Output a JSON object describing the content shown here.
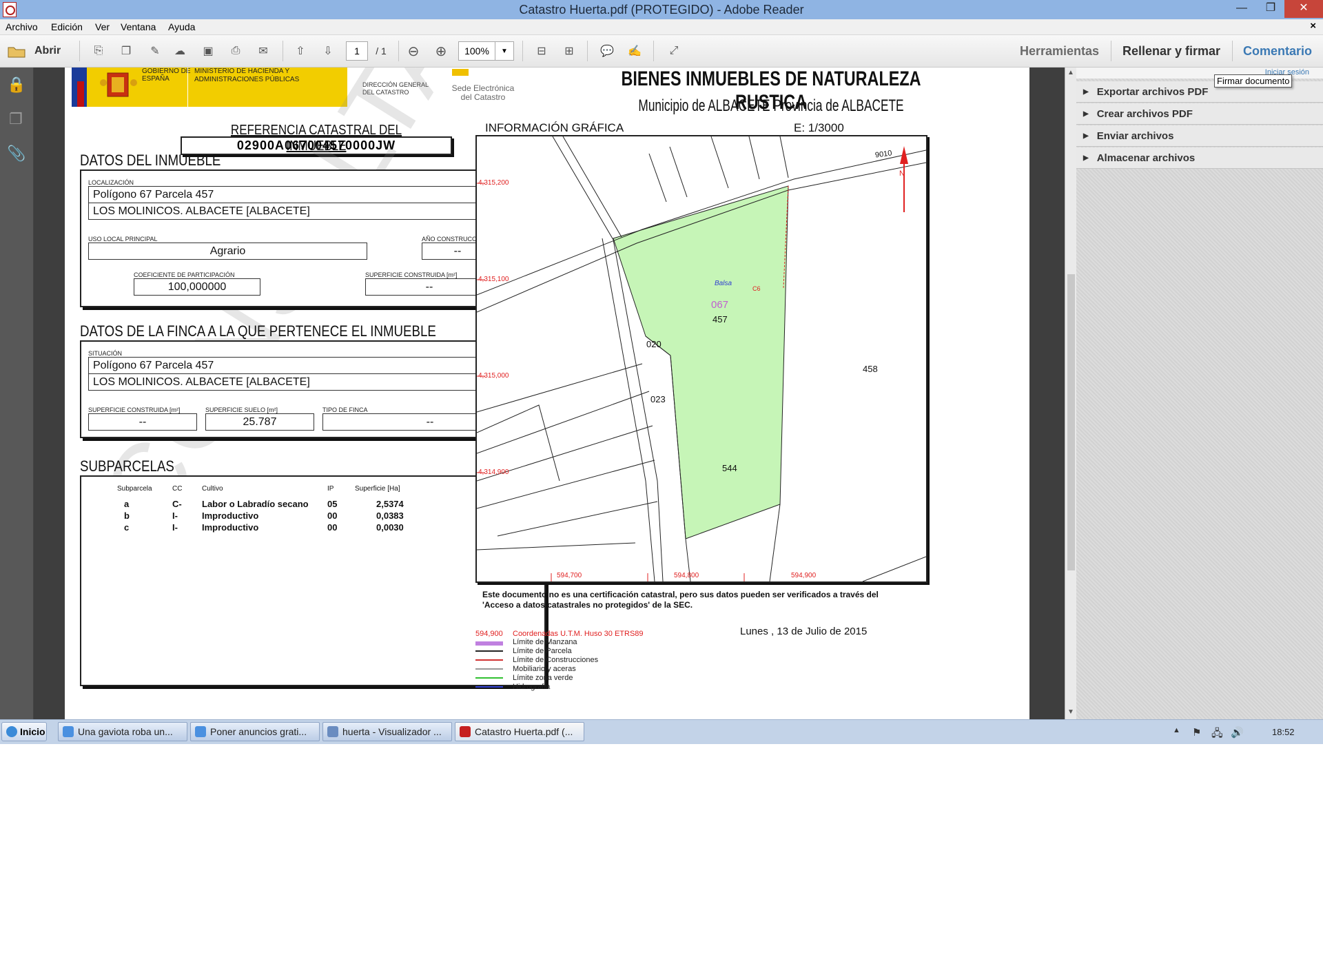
{
  "window": {
    "title": "Catastro Huerta.pdf (PROTEGIDO) - Adobe Reader",
    "min": "—",
    "max": "❐",
    "close": "✕"
  },
  "menu": [
    "Archivo",
    "Edición",
    "Ver",
    "Ventana",
    "Ayuda"
  ],
  "menu_close": "×",
  "toolbar": {
    "open_label": "Abrir",
    "page_current": "1",
    "page_total": "/ 1",
    "zoom": "100%",
    "tools_label": "Herramientas",
    "fill_sign_label": "Rellenar y firmar",
    "comment_label": "Comentario"
  },
  "task_pane": {
    "login_text": "Iniciar sesión",
    "tooltip": "Firmar documento",
    "items": [
      "Exportar archivos PDF",
      "Crear archivos PDF",
      "Enviar archivos",
      "Almacenar archivos"
    ]
  },
  "document": {
    "logos": {
      "gov": "GOBIERNO DE ESPAÑA",
      "ministry": "MINISTERIO DE HACIENDA Y ADMINISTRACIONES PÚBLICAS",
      "direction": "DIRECCIÓN GENERAL DEL CATASTRO",
      "sede": "Sede Electrónica del Catastro"
    },
    "main_title": "BIENES INMUEBLES DE NATURALEZA RUSTICA",
    "subtitle": "Municipio de ALBACETE Provincia de ALBACETE",
    "ref_title": "REFERENCIA CATASTRAL DEL INMUEBLE",
    "ref_value": "02900A067004570000JW",
    "watermark": "CONSULTA",
    "datos_inmueble": {
      "title": "DATOS DEL INMUEBLE",
      "loc_label": "LOCALIZACIÓN",
      "loc_line1": "Polígono 67 Parcela 457",
      "loc_line2": "LOS MOLINICOS. ALBACETE [ALBACETE]",
      "uso_label": "USO LOCAL PRINCIPAL",
      "uso_value": "Agrario",
      "anio_label": "AÑO CONSTRUCCIÓN",
      "anio_value": "--",
      "coef_label": "COEFICIENTE DE PARTICIPACIÓN",
      "coef_value": "100,000000",
      "sup_label": "SUPERFICIE CONSTRUIDA [m²]",
      "sup_value": "--"
    },
    "datos_finca": {
      "title": "DATOS DE LA FINCA A LA QUE PERTENECE EL INMUEBLE",
      "sit_label": "SITUACIÓN",
      "sit_line1": "Polígono 67 Parcela 457",
      "sit_line2": "LOS MOLINICOS. ALBACETE [ALBACETE]",
      "sc_label": "SUPERFICIE CONSTRUIDA [m²]",
      "sc_value": "--",
      "ss_label": "SUPERFICIE SUELO [m²]",
      "ss_value": "25.787",
      "tf_label": "TIPO DE FINCA",
      "tf_value": "--"
    },
    "subparcelas": {
      "title": "SUBPARCELAS",
      "headers": [
        "Subparcela",
        "CC",
        "Cultivo",
        "IP",
        "Superficie [Ha]"
      ],
      "rows": [
        [
          "a",
          "C-",
          "Labor o Labradío secano",
          "05",
          "2,5374"
        ],
        [
          "b",
          "I-",
          "Improductivo",
          "00",
          "0,0383"
        ],
        [
          "c",
          "I-",
          "Improductivo",
          "00",
          "0,0030"
        ]
      ]
    },
    "map": {
      "info_label": "INFORMACIÓN GRÁFICA",
      "scale": "E: 1/3000",
      "y_ticks": [
        "4,315,200",
        "4,315,100",
        "4,315,000",
        "4,314,900"
      ],
      "x_ticks": [
        "594,700",
        "594,800",
        "594,900"
      ],
      "labels": {
        "balsa": "Balsa",
        "polygon": "067",
        "parcel": "457",
        "p020": "020",
        "p023": "023",
        "p458": "458",
        "p544": "544",
        "p9010": "9010",
        "north": "N",
        "c6": "C6"
      },
      "colors": {
        "parcel_fill": "#c6f5b7",
        "grid_red": "#e02020"
      }
    },
    "disclaimer_line1": "Este documento no es una certificación catastral, pero sus datos pueden ser verificados a través del",
    "disclaimer_line2": "'Acceso a datos catastrales no protegidos' de la SEC.",
    "date": "Lunes , 13 de Julio de 2015",
    "legend": {
      "coord_value": "594,900",
      "coord_text": "Coordenadas U.T.M. Huso 30 ETRS89",
      "items": [
        {
          "label": "Límite de Manzana",
          "color": "#c080e0"
        },
        {
          "label": "Límite de Parcela",
          "color": "#222222"
        },
        {
          "label": "Límite de Construcciones",
          "color": "#d03030"
        },
        {
          "label": "Mobiliario y aceras",
          "color": "#999999"
        },
        {
          "label": "Límite zona verde",
          "color": "#30c030"
        },
        {
          "label": "Hidrografía",
          "color": "#3040d0"
        }
      ]
    }
  },
  "taskbar": {
    "start": "Inicio",
    "tasks": [
      "Una gaviota roba un...",
      "Poner anuncios grati...",
      "huerta - Visualizador ...",
      "Catastro Huerta.pdf (..."
    ],
    "clock": "18:52"
  }
}
